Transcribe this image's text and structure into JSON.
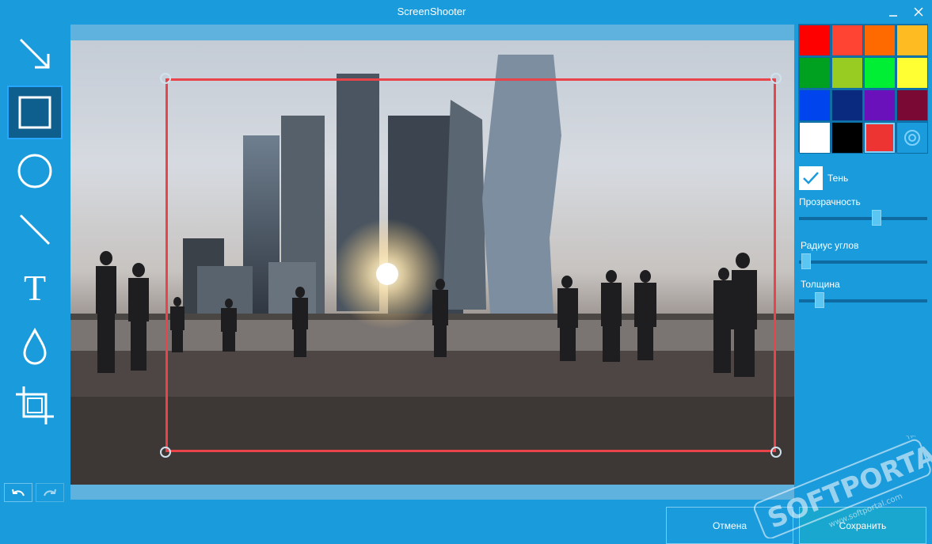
{
  "window": {
    "title": "ScreenShooter"
  },
  "tools": [
    {
      "id": "arrow",
      "icon": "arrow-icon",
      "active": false
    },
    {
      "id": "rectangle",
      "icon": "rectangle-icon",
      "active": true
    },
    {
      "id": "ellipse",
      "icon": "ellipse-icon",
      "active": false
    },
    {
      "id": "line",
      "icon": "line-icon",
      "active": false
    },
    {
      "id": "text",
      "icon": "text-icon",
      "label": "T",
      "active": false
    },
    {
      "id": "blur",
      "icon": "drop-icon",
      "active": false
    },
    {
      "id": "crop",
      "icon": "crop-icon",
      "active": false
    }
  ],
  "palette": {
    "colors": [
      "#ff0000",
      "#ff4433",
      "#ff6a00",
      "#ffbb22",
      "#00a020",
      "#99cc22",
      "#00ee33",
      "#ffff33",
      "#0044ee",
      "#0a2a80",
      "#6a11bb",
      "#7a0a33",
      "#ffffff",
      "#000000",
      "#ee3333"
    ],
    "selected_index": 14,
    "picker_icon": "color-picker-icon"
  },
  "options": {
    "shadow_label": "Тень",
    "shadow_checked": true,
    "opacity_label": "Прозрачность",
    "opacity_value": 0.61,
    "corner_radius_label": "Радиус углов",
    "corner_radius_value": 0.02,
    "thickness_label": "Толщина",
    "thickness_value": 0.13
  },
  "buttons": {
    "cancel": "Отмена",
    "save": "Сохранить"
  },
  "watermark": {
    "brand": "SOFTPORTAL",
    "url": "www.softportal.com",
    "tm": "TM"
  }
}
